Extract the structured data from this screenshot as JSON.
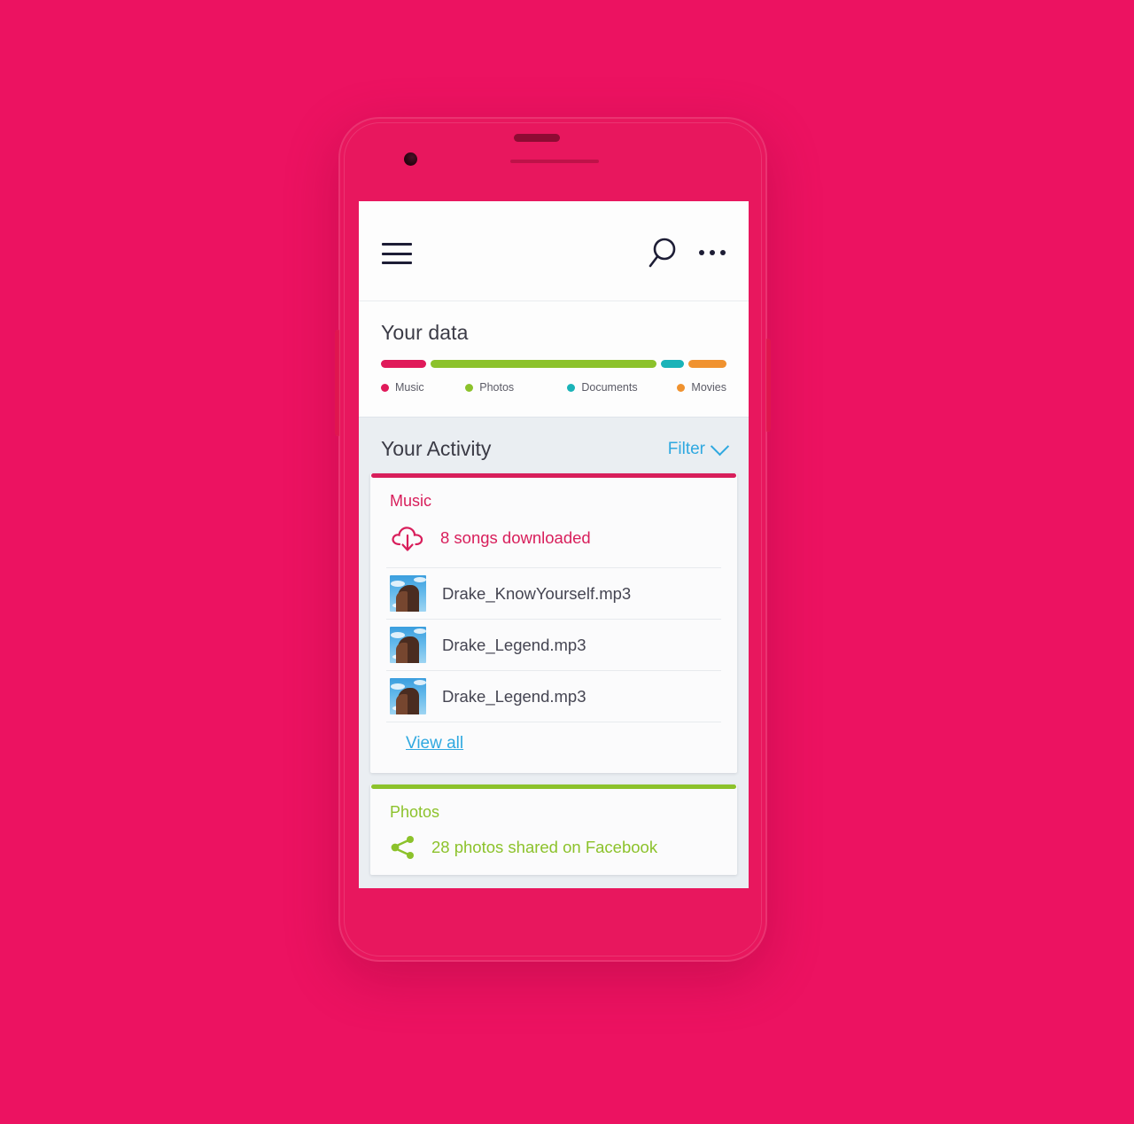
{
  "theme": {
    "background_pink": "#ec1261",
    "frame_pink": "#e8175e",
    "accent_crimson": "#d81e5b",
    "accent_green": "#8cc22b",
    "accent_teal": "#1ab3b8",
    "accent_orange": "#f0922f",
    "link_blue": "#2fa8e0"
  },
  "app_bar": {
    "menu_icon": "hamburger-menu-icon",
    "search_icon": "search-icon",
    "more_icon": "more-options-icon"
  },
  "your_data": {
    "title": "Your data",
    "legend": [
      {
        "label": "Music",
        "color": "#e01a5a"
      },
      {
        "label": "Photos",
        "color": "#8cc22b"
      },
      {
        "label": "Documents",
        "color": "#1ab3b8"
      },
      {
        "label": "Movies",
        "color": "#f0922f"
      }
    ]
  },
  "chart_data": {
    "type": "bar",
    "title": "Your data",
    "orientation": "horizontal-stacked",
    "categories": [
      "Music",
      "Photos",
      "Documents",
      "Movies"
    ],
    "values": [
      13,
      66,
      7,
      11
    ],
    "unit": "percent of bar width",
    "colors": [
      "#e01a5a",
      "#8cc22b",
      "#1ab3b8",
      "#f0922f"
    ],
    "grid": false,
    "legend_position": "below",
    "xlabel": "",
    "ylabel": ""
  },
  "activity": {
    "title": "Your Activity",
    "filter_label": "Filter",
    "filter_chevron_icon": "chevron-down-icon",
    "cards": [
      {
        "id": "music",
        "title": "Music",
        "accent": "#d81e5b",
        "summary_icon": "cloud-download-icon",
        "summary": "8 songs downloaded",
        "tracks": [
          {
            "name": "Drake_KnowYourself.mp3"
          },
          {
            "name": "Drake_Legend.mp3"
          },
          {
            "name": "Drake_Legend.mp3"
          }
        ],
        "view_all_label": "View all"
      },
      {
        "id": "photos",
        "title": "Photos",
        "accent": "#8cc22b",
        "summary_icon": "share-icon",
        "summary": "28 photos shared on Facebook"
      }
    ]
  }
}
